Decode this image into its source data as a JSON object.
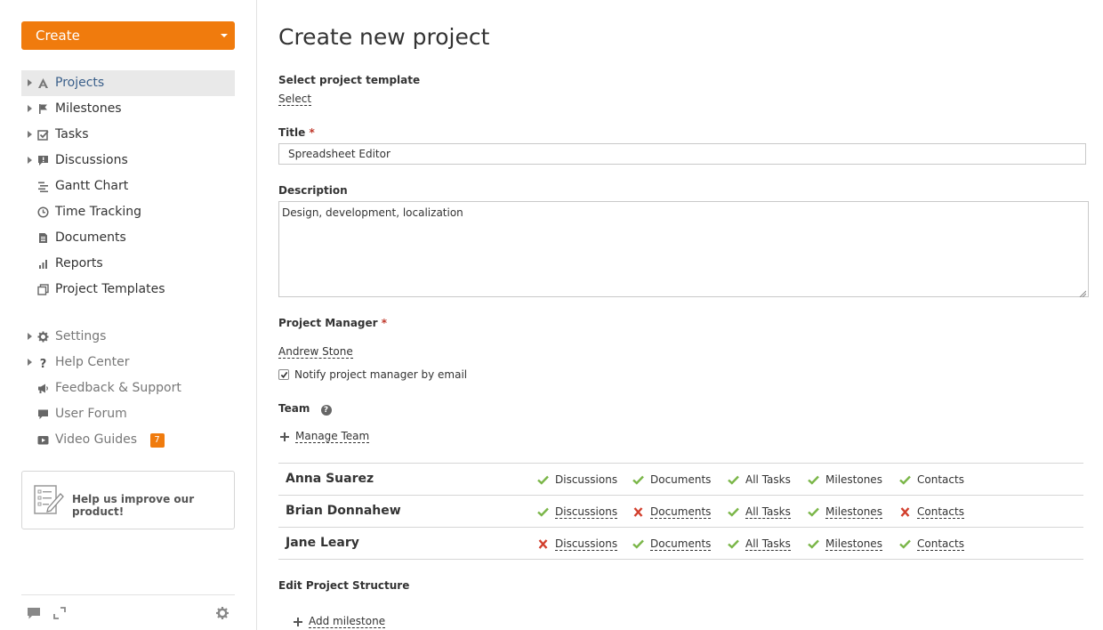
{
  "sidebar": {
    "create_label": "Create",
    "nav": [
      {
        "label": "Projects",
        "icon": "projects-icon",
        "active": true,
        "arrow": true
      },
      {
        "label": "Milestones",
        "icon": "flag-icon",
        "arrow": true
      },
      {
        "label": "Tasks",
        "icon": "checkbox-icon",
        "arrow": true
      },
      {
        "label": "Discussions",
        "icon": "discussion-icon",
        "arrow": true
      },
      {
        "label": "Gantt Chart",
        "icon": "gantt-icon"
      },
      {
        "label": "Time Tracking",
        "icon": "clock-icon"
      },
      {
        "label": "Documents",
        "icon": "document-icon"
      },
      {
        "label": "Reports",
        "icon": "reports-icon"
      },
      {
        "label": "Project Templates",
        "icon": "templates-icon"
      }
    ],
    "nav2": [
      {
        "label": "Settings",
        "icon": "gear-icon",
        "arrow": true
      },
      {
        "label": "Help Center",
        "icon": "question-icon",
        "arrow": true
      },
      {
        "label": "Feedback & Support",
        "icon": "megaphone-icon"
      },
      {
        "label": "User Forum",
        "icon": "forum-icon"
      },
      {
        "label": "Video Guides",
        "icon": "video-icon",
        "badge": "7"
      }
    ],
    "help_box_text": "Help us improve our product!"
  },
  "main": {
    "page_title": "Create new project",
    "template_label": "Select project template",
    "template_link": "Select",
    "title_label": "Title",
    "title_value": "Spreadsheet Editor",
    "description_label": "Description",
    "description_value": "Design, development, localization",
    "pm_label": "Project Manager",
    "pm_value": "Andrew Stone",
    "notify_label": "Notify project manager by email",
    "notify_checked": true,
    "team_label": "Team",
    "manage_team": "Manage Team",
    "team": [
      {
        "name": "Anna Suarez",
        "perms": [
          {
            "label": "Discussions",
            "allowed": true,
            "link": false
          },
          {
            "label": "Documents",
            "allowed": true,
            "link": false
          },
          {
            "label": "All Tasks",
            "allowed": true,
            "link": false
          },
          {
            "label": "Milestones",
            "allowed": true,
            "link": false
          },
          {
            "label": "Contacts",
            "allowed": true,
            "link": false
          }
        ]
      },
      {
        "name": "Brian Donnahew",
        "perms": [
          {
            "label": "Discussions",
            "allowed": true,
            "link": true
          },
          {
            "label": "Documents",
            "allowed": false,
            "link": true
          },
          {
            "label": "All Tasks",
            "allowed": true,
            "link": true
          },
          {
            "label": "Milestones",
            "allowed": true,
            "link": true
          },
          {
            "label": "Contacts",
            "allowed": false,
            "link": true
          }
        ]
      },
      {
        "name": "Jane Leary",
        "perms": [
          {
            "label": "Discussions",
            "allowed": false,
            "link": true
          },
          {
            "label": "Documents",
            "allowed": true,
            "link": true
          },
          {
            "label": "All Tasks",
            "allowed": true,
            "link": true
          },
          {
            "label": "Milestones",
            "allowed": true,
            "link": true
          },
          {
            "label": "Contacts",
            "allowed": true,
            "link": true
          }
        ]
      }
    ],
    "structure_label": "Edit Project Structure",
    "add_milestone": "Add milestone"
  },
  "colors": {
    "accent": "#f07b0d",
    "active_link": "#3a5f8a",
    "check_green": "#7ab648",
    "cross_red": "#d23f2d"
  }
}
